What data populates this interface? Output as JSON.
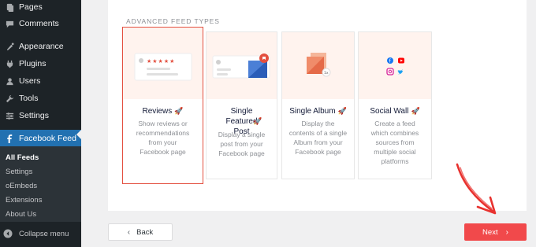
{
  "sidebar": {
    "items": [
      {
        "label": "Pages",
        "icon": "pages-icon"
      },
      {
        "label": "Comments",
        "icon": "comments-icon"
      },
      {
        "label": "Appearance",
        "icon": "appearance-icon"
      },
      {
        "label": "Plugins",
        "icon": "plugins-icon"
      },
      {
        "label": "Users",
        "icon": "users-icon"
      },
      {
        "label": "Tools",
        "icon": "tools-icon"
      },
      {
        "label": "Settings",
        "icon": "settings-icon"
      },
      {
        "label": "Facebook Feed",
        "icon": "facebook-icon",
        "active": true
      }
    ],
    "submenu": [
      "All Feeds",
      "Settings",
      "oEmbeds",
      "Extensions",
      "About Us"
    ],
    "submenu_current": "All Feeds",
    "collapse_label": "Collapse menu"
  },
  "main": {
    "section_title": "ADVANCED FEED TYPES",
    "cards": [
      {
        "title": "Reviews",
        "desc": [
          "Show reviews or",
          "recommendations",
          "from your",
          "Facebook page"
        ],
        "selected": true
      },
      {
        "title": "Single Featured Post",
        "desc": [
          "Display a single",
          "post from your",
          "Facebook page"
        ]
      },
      {
        "title": "Single Album",
        "desc": [
          "Display the",
          "contents of a single",
          "Album from your",
          "Facebook page"
        ]
      },
      {
        "title": "Social Wall",
        "desc": [
          "Create a feed",
          "which combines",
          "sources from",
          "multiple social",
          "platforms"
        ]
      }
    ],
    "album_badge": "1x"
  },
  "footer": {
    "back_label": "Back",
    "next_label": "Next"
  },
  "colors": {
    "sidebar_bg": "#1d2327",
    "active_blue": "#2271b1",
    "accent_red": "#e34f3f",
    "next_red": "#f1494b",
    "thumb_bg": "#fff3ee"
  }
}
